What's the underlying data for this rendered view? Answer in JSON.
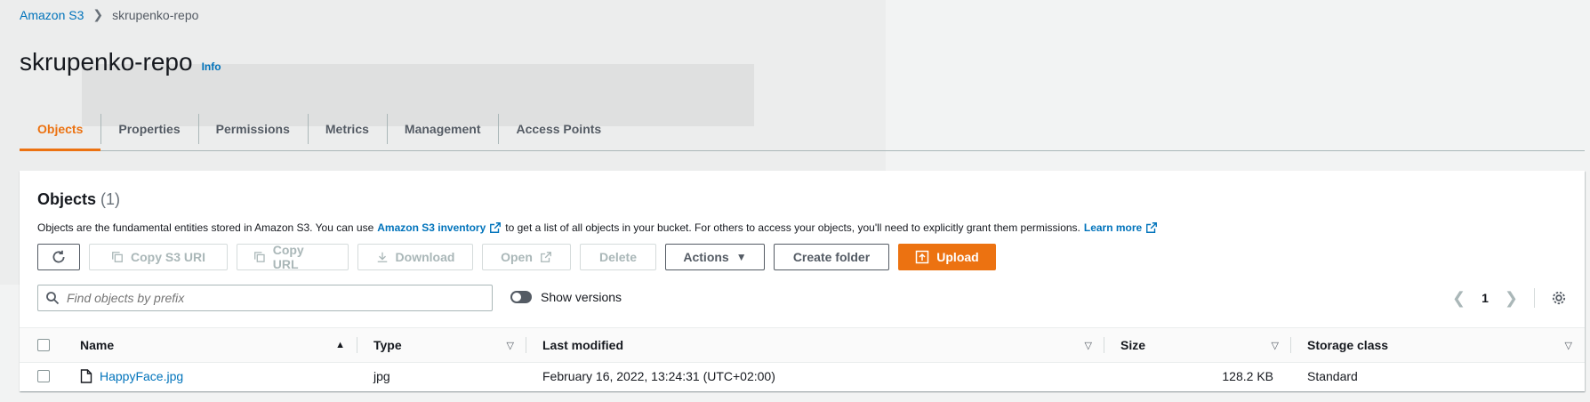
{
  "breadcrumb": {
    "root": "Amazon S3",
    "current": "skrupenko-repo"
  },
  "header": {
    "title": "skrupenko-repo",
    "info": "Info"
  },
  "tabs": [
    {
      "label": "Objects",
      "active": true
    },
    {
      "label": "Properties"
    },
    {
      "label": "Permissions"
    },
    {
      "label": "Metrics"
    },
    {
      "label": "Management"
    },
    {
      "label": "Access Points"
    }
  ],
  "objects": {
    "title": "Objects",
    "count": "(1)",
    "desc_before": "Objects are the fundamental entities stored in Amazon S3. You can use",
    "inventory_link": "Amazon S3 inventory",
    "desc_after": "to get a list of all objects in your bucket. For others to access your objects, you'll need to explicitly grant them permissions.",
    "learn_more": "Learn more"
  },
  "toolbar": {
    "copy_s3_uri": "Copy S3 URI",
    "copy_url": "Copy URL",
    "download": "Download",
    "open": "Open",
    "delete": "Delete",
    "actions": "Actions",
    "create_folder": "Create folder",
    "upload": "Upload"
  },
  "search": {
    "placeholder": "Find objects by prefix"
  },
  "show_versions": "Show versions",
  "pager": {
    "page": "1"
  },
  "table": {
    "headers": {
      "name": "Name",
      "type": "Type",
      "modified": "Last modified",
      "size": "Size",
      "class": "Storage class"
    },
    "rows": [
      {
        "name": "HappyFace.jpg",
        "type": "jpg",
        "modified": "February 16, 2022, 13:24:31 (UTC+02:00)",
        "size": "128.2 KB",
        "class": "Standard"
      }
    ]
  },
  "colors": {
    "accent": "#ec7211",
    "link": "#0073bb"
  }
}
